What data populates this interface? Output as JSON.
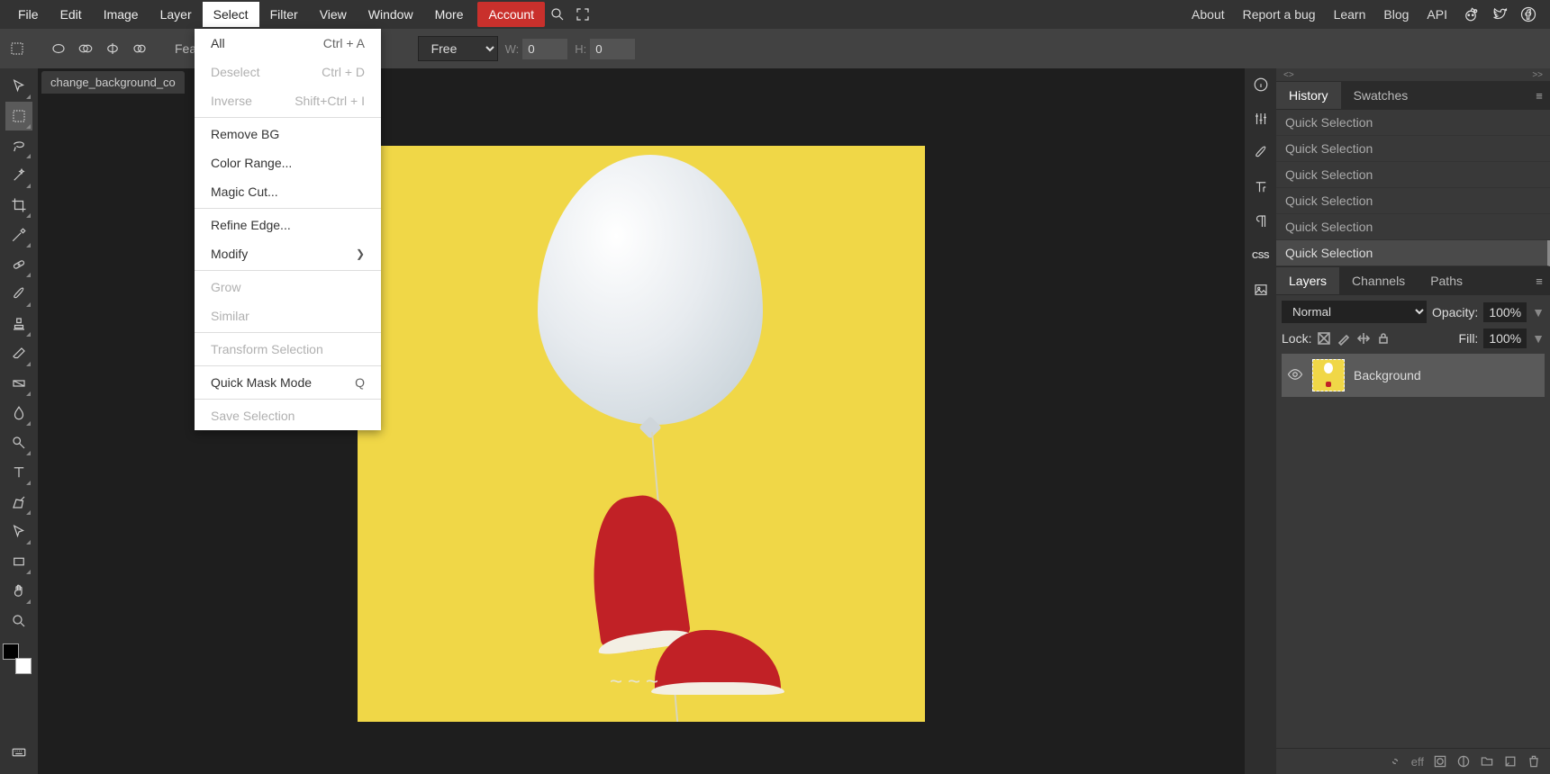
{
  "menubar": {
    "items": [
      "File",
      "Edit",
      "Image",
      "Layer",
      "Select",
      "Filter",
      "View",
      "Window",
      "More",
      "Account"
    ],
    "active_index": 4,
    "right_links": [
      "About",
      "Report a bug",
      "Learn",
      "Blog",
      "API"
    ]
  },
  "options": {
    "feather_label": "Feathe",
    "ratio_select": "Free",
    "w_label": "W:",
    "w_value": "0",
    "h_label": "H:",
    "h_value": "0"
  },
  "dropdown": {
    "items": [
      {
        "label": "All",
        "shortcut": "Ctrl + A",
        "disabled": false
      },
      {
        "label": "Deselect",
        "shortcut": "Ctrl + D",
        "disabled": true
      },
      {
        "label": "Inverse",
        "shortcut": "Shift+Ctrl + I",
        "disabled": true
      },
      {
        "sep": true
      },
      {
        "label": "Remove BG",
        "shortcut": "",
        "disabled": false
      },
      {
        "label": "Color Range...",
        "shortcut": "",
        "disabled": false
      },
      {
        "label": "Magic Cut...",
        "shortcut": "",
        "disabled": false
      },
      {
        "sep": true
      },
      {
        "label": "Refine Edge...",
        "shortcut": "",
        "disabled": false
      },
      {
        "label": "Modify",
        "shortcut": "",
        "disabled": false,
        "submenu": true
      },
      {
        "sep": true
      },
      {
        "label": "Grow",
        "shortcut": "",
        "disabled": true
      },
      {
        "label": "Similar",
        "shortcut": "",
        "disabled": true
      },
      {
        "sep": true
      },
      {
        "label": "Transform Selection",
        "shortcut": "",
        "disabled": true
      },
      {
        "sep": true
      },
      {
        "label": "Quick Mask Mode",
        "shortcut": "Q",
        "disabled": false
      },
      {
        "sep": true
      },
      {
        "label": "Save Selection",
        "shortcut": "",
        "disabled": true
      }
    ]
  },
  "doc": {
    "tab_label": "change_background_co"
  },
  "right_panels": {
    "arrow_left": "<>",
    "arrow_right": ">>",
    "history_tab": "History",
    "swatches_tab": "Swatches",
    "history": [
      "Quick Selection",
      "Quick Selection",
      "Quick Selection",
      "Quick Selection",
      "Quick Selection",
      "Quick Selection"
    ],
    "layers_tab": "Layers",
    "channels_tab": "Channels",
    "paths_tab": "Paths",
    "blend_mode": "Normal",
    "opacity_label": "Opacity:",
    "opacity_value": "100%",
    "lock_label": "Lock:",
    "fill_label": "Fill:",
    "fill_value": "100%",
    "layer_name": "Background",
    "footer_eff": "eff"
  }
}
